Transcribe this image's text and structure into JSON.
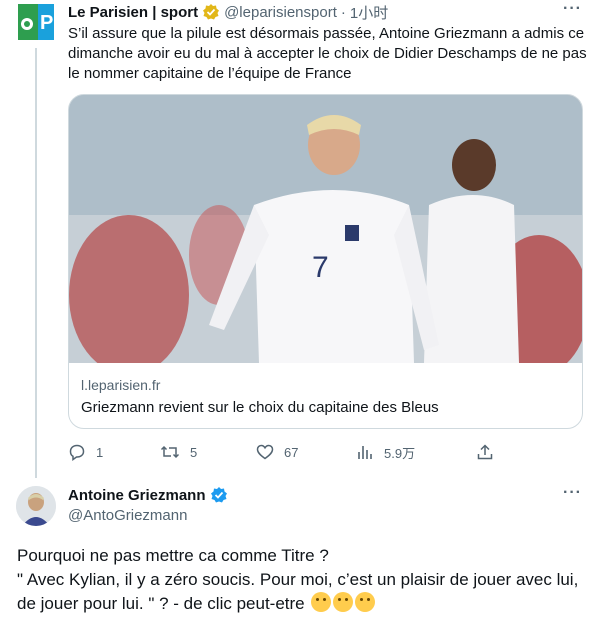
{
  "tweet": {
    "author_name": "Le Parisien | sport",
    "author_handle": "@leparisiensport",
    "separator": "·",
    "time": "1小时",
    "text": "S’il assure que la pilule est désormais passée, Antoine Griezmann a admis ce dimanche avoir eu du mal à accepter le choix de Didier Deschamps de ne pas le nommer capitaine de l’équipe de France",
    "card": {
      "domain": "l.leparisien.fr",
      "title": "Griezmann revient sur le choix du capitaine des Bleus",
      "jersey_number": "7"
    },
    "actions": {
      "reply_count": "1",
      "retweet_count": "5",
      "like_count": "67",
      "views_count": "5.9万"
    }
  },
  "reply": {
    "author_name": "Antoine Griezmann",
    "author_handle": "@AntoGriezmann",
    "text_line1": "Pourquoi ne pas mettre ca comme Titre ?",
    "text_line2": "\" Avec Kylian, il y a zéro soucis.  Pour moi, c’est un plaisir de jouer avec lui, de jouer pour lui. \" ? - de clic peut-etre",
    "emojis": [
      "thinking-face",
      "thinking-face",
      "thinking-face"
    ]
  },
  "colors": {
    "text": "#0f1419",
    "secondary": "#536471",
    "gold_badge": "#e2b719",
    "blue_badge": "#1d9bf0",
    "border": "#cfd9de"
  }
}
